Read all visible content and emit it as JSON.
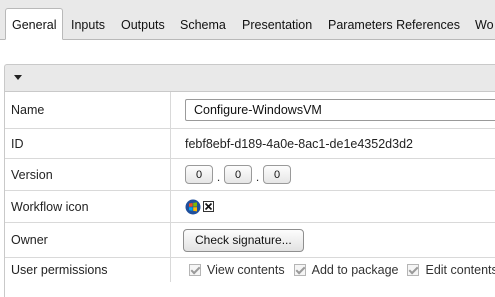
{
  "tabs": [
    {
      "label": "General",
      "active": true
    },
    {
      "label": "Inputs"
    },
    {
      "label": "Outputs"
    },
    {
      "label": "Schema"
    },
    {
      "label": "Presentation"
    },
    {
      "label": "Parameters References"
    },
    {
      "label": "Wo"
    }
  ],
  "form": {
    "name_label": "Name",
    "name_value": "Configure-WindowsVM",
    "id_label": "ID",
    "id_value": "febf8ebf-d189-4a0e-8ac1-de1e4352d3d2",
    "version_label": "Version",
    "version_major": "0",
    "version_minor": "0",
    "version_patch": "0",
    "version_sep": ".",
    "icon_label": "Workflow icon",
    "workflow_icon": "windows-logo-icon",
    "remove_icon": "close-box-icon",
    "owner_label": "Owner",
    "check_signature": "Check signature...",
    "permissions_label": "User permissions",
    "permissions": [
      {
        "label": "View contents",
        "checked": true
      },
      {
        "label": "Add to package",
        "checked": true
      },
      {
        "label": "Edit contents",
        "checked": true
      }
    ]
  },
  "colors": {
    "accent": "#2a6ebb"
  }
}
